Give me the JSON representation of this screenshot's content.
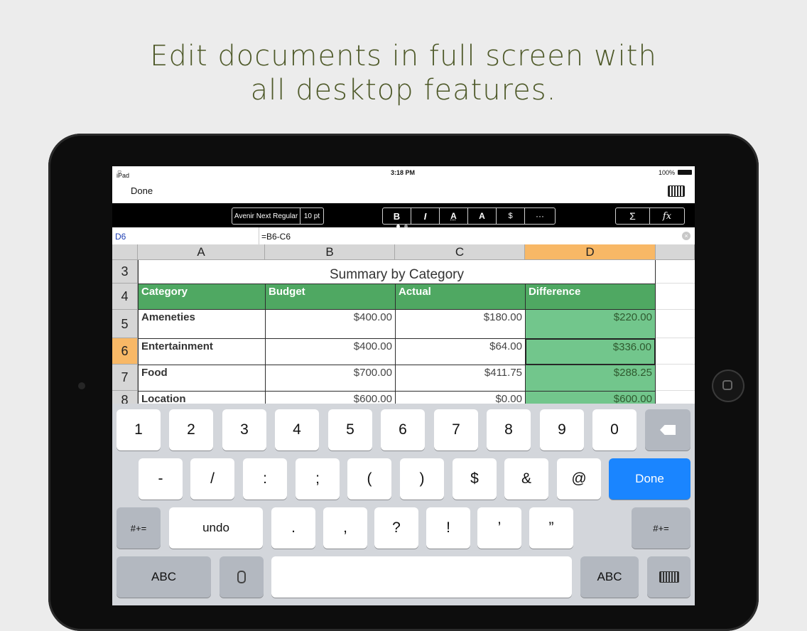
{
  "headline": {
    "line1": "Edit documents in full screen with",
    "line2": "all desktop features."
  },
  "status": {
    "device": "iPad",
    "time": "3:18 PM",
    "battery": "100%"
  },
  "nav": {
    "done": "Done"
  },
  "toolbar": {
    "font_name": "Avenir Next Regular",
    "font_size": "10 pt",
    "bold": "B",
    "italic": "I",
    "text_color": "A",
    "highlight": "A",
    "currency": "$",
    "more": "···",
    "sum": "Σ",
    "function": "fx"
  },
  "formula_bar": {
    "cell_ref": "D6",
    "formula": "=B6-C6",
    "clear": "×"
  },
  "sheet": {
    "columns": [
      "A",
      "B",
      "C",
      "D"
    ],
    "rows": [
      "3",
      "4",
      "5",
      "6",
      "7",
      "8"
    ],
    "title": "Summary by Category",
    "headers": [
      "Category",
      "Budget",
      "Actual",
      "Difference"
    ],
    "data": [
      [
        "Ameneties",
        "$400.00",
        "$180.00",
        "$220.00"
      ],
      [
        "Entertainment",
        "$400.00",
        "$64.00",
        "$336.00"
      ],
      [
        "Food",
        "$700.00",
        "$411.75",
        "$288.25"
      ],
      [
        "Location",
        "$600.00",
        "$0.00",
        "$600.00"
      ]
    ]
  },
  "keyboard": {
    "row1": [
      "1",
      "2",
      "3",
      "4",
      "5",
      "6",
      "7",
      "8",
      "9",
      "0"
    ],
    "row2": [
      "-",
      "/",
      ":",
      ";",
      "(",
      ")",
      "$",
      "&",
      "@"
    ],
    "done": "Done",
    "row3_left": "#+=",
    "undo": "undo",
    "row3": [
      ".",
      ",",
      "?",
      "!",
      "’",
      "”"
    ],
    "row3_right": "#+=",
    "abc_left": "ABC",
    "abc_right": "ABC"
  }
}
